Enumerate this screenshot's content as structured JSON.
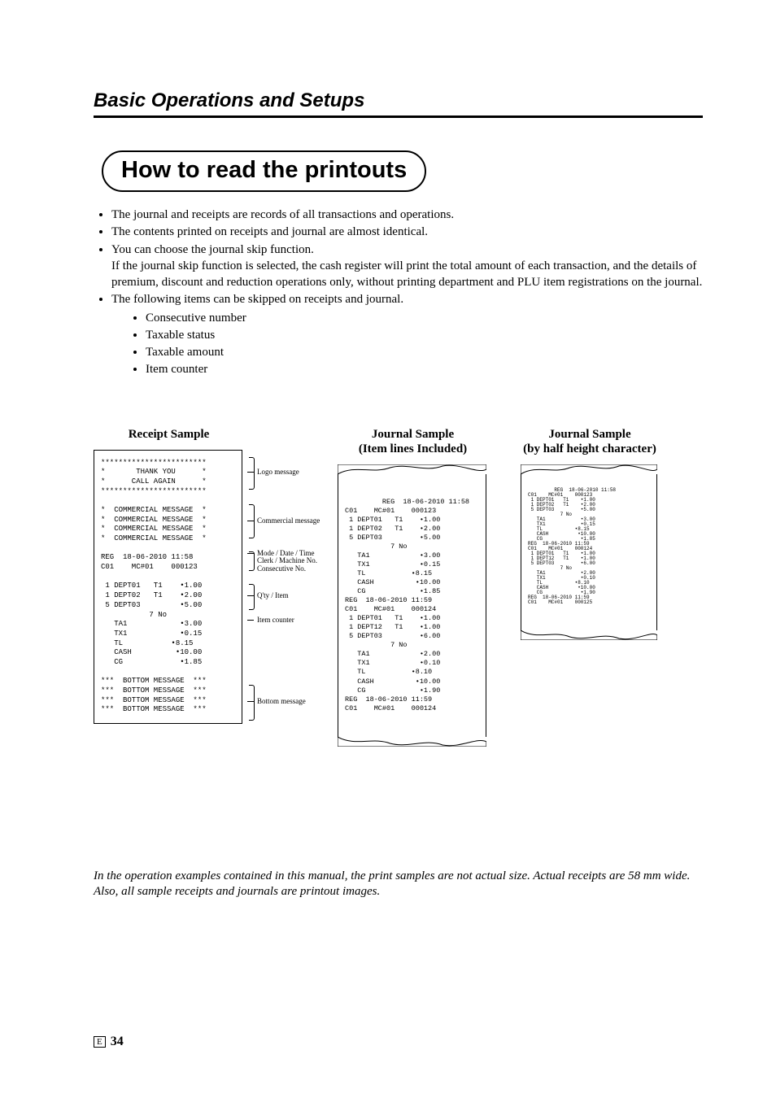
{
  "section_header": "Basic Operations and Setups",
  "page_title": "How to read the printouts",
  "intro": {
    "b1": "The journal and receipts are records of all transactions and operations.",
    "b2": "The contents printed on receipts and journal are almost identical.",
    "b3a": "You can choose the journal skip function.",
    "b3b": "If the journal skip function is selected, the cash register will print the total amount of each transaction, and the details of premium, discount and reduction operations only, without printing department and PLU item registrations on the journal.",
    "b4": "The following items can be skipped on receipts and journal.",
    "b4s1": "Consecutive number",
    "b4s2": "Taxable status",
    "b4s3": "Taxable amount",
    "b4s4": "Item counter"
  },
  "titles": {
    "receipt": "Receipt Sample",
    "journal1a": "Journal Sample",
    "journal1b": "(Item lines Included)",
    "journal2a": "Journal Sample",
    "journal2b": "(by half height character)"
  },
  "annotations": {
    "a1": "Logo message",
    "a2": "Commercial message",
    "a3": "Mode / Date / Time\nClerk / Machine No.\nConsecutive No.",
    "a4": "Q'ty / Item",
    "a5": "Item counter",
    "a6": "Bottom message"
  },
  "receipt_text": "************************\n*       THANK YOU      *\n*      CALL AGAIN      *\n************************\n\n*  COMMERCIAL MESSAGE  *\n*  COMMERCIAL MESSAGE  *\n*  COMMERCIAL MESSAGE  *\n*  COMMERCIAL MESSAGE  *\n\nREG  18-06-2010 11:58\nC01    MC#01    000123\n\n 1 DEPT01   T1    •1.00\n 1 DEPT02   T1    •2.00\n 5 DEPT03         •5.00\n           7 No\n   TA1            •3.00\n   TX1            •0.15\n   TL           •8.15\n   CASH          •10.00\n   CG             •1.85\n\n***  BOTTOM MESSAGE  ***\n***  BOTTOM MESSAGE  ***\n***  BOTTOM MESSAGE  ***\n***  BOTTOM MESSAGE  ***",
  "journal1_text": " REG  18-06-2010 11:58\nC01    MC#01    000123\n 1 DEPT01   T1    •1.00\n 1 DEPT02   T1    •2.00\n 5 DEPT03         •5.00\n           7 No\n   TA1            •3.00\n   TX1            •0.15\n   TL           •8.15\n   CASH          •10.00\n   CG             •1.85\nREG  18-06-2010 11:59\nC01    MC#01    000124\n 1 DEPT01   T1    •1.00\n 1 DEPT12   T1    •1.00\n 5 DEPT03         •6.00\n           7 No\n   TA1            •2.00\n   TX1            •0.10\n   TL           •8.10\n   CASH          •10.00\n   CG             •1.90\nREG  18-06-2010 11:59\nC01    MC#01    000124",
  "journal2_text": " REG  18-06-2010 11:58\nC01    MC#01    000123\n 1 DEPT01   T1    •1.00\n 1 DEPT02   T1    •2.00\n 5 DEPT03         •5.00\n           7 No\n   TA1            •3.00\n   TX1            •0.15\n   TL           •8.15\n   CASH          •10.00\n   CG             •1.85\nREG  18-06-2010 11:59\nC01    MC#01    000124\n 1 DEPT01   T1    •1.00\n 1 DEPT12   T1    •1.00\n 5 DEPT03         •6.00\n           7 No\n   TA1            •2.00\n   TX1            •0.10\n   TL           •8.10\n   CASH          •10.00\n   CG             •1.90\nREG  18-06-2010 11:59\nC01    MC#01    000125",
  "note": "In the operation examples contained in this manual, the print samples are not actual size. Actual receipts are 58 mm wide. Also, all sample receipts and journals are printout images.",
  "page_letter": "E",
  "page_number": "34"
}
